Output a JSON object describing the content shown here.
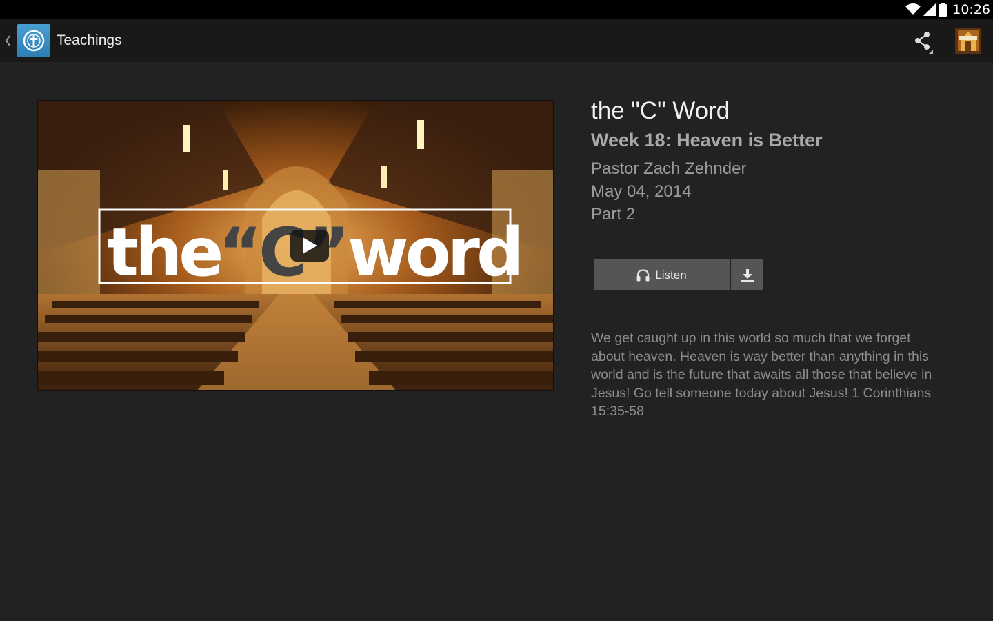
{
  "status_bar": {
    "time": "10:26",
    "icons": [
      "wifi-icon",
      "signal-icon",
      "battery-icon"
    ]
  },
  "action_bar": {
    "title": "Teachings",
    "app_icon": "cross-icon",
    "actions": [
      "share-icon",
      "church-avatar"
    ]
  },
  "video": {
    "thumbnail_text": {
      "the": "the",
      "quote_c": "“C”",
      "word": "word"
    },
    "play_icon": "play-icon"
  },
  "sermon": {
    "series_title": "the \"C\" Word",
    "title": "Week 18: Heaven is Better",
    "speaker": "Pastor Zach Zehnder",
    "date": "May 04, 2014",
    "part": "Part 2",
    "listen_label": "Listen",
    "description": "We get caught up in this world so much that we forget about heaven. Heaven is way better than anything in this world and is the future that awaits all those that believe in Jesus! Go tell someone today about Jesus! 1 Corinthians 15:35-58"
  },
  "colors": {
    "background": "#222223",
    "action_bar": "#19191a",
    "button": "#555557",
    "app_icon": "#3b8fc7"
  }
}
